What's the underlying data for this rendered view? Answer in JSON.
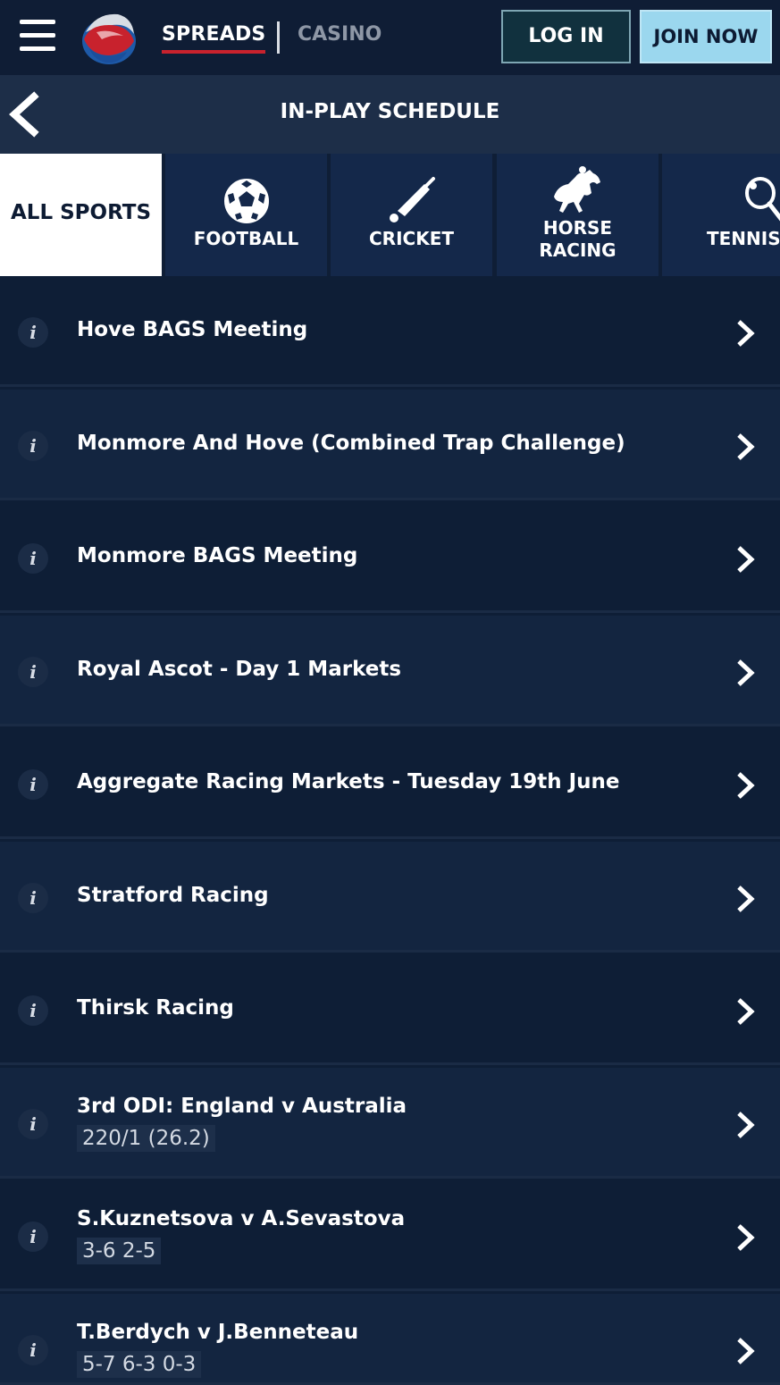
{
  "header": {
    "nav_spreads": "SPREADS",
    "nav_casino": "CASINO",
    "login_label": "LOG IN",
    "join_label": "JOIN NOW"
  },
  "subheader": {
    "title": "IN-PLAY SCHEDULE"
  },
  "sports_tabs": [
    {
      "label": "ALL SPORTS",
      "icon": "none",
      "active": true
    },
    {
      "label": "FOOTBALL",
      "icon": "football-icon",
      "active": false
    },
    {
      "label": "CRICKET",
      "icon": "cricket-bat-icon",
      "active": false
    },
    {
      "label_line1": "HORSE",
      "label_line2": "RACING",
      "icon": "horse-racing-icon",
      "active": false
    },
    {
      "label": "TENNIS",
      "icon": "tennis-racket-icon",
      "active": false
    }
  ],
  "events": [
    {
      "title": "Hove BAGS Meeting",
      "score": ""
    },
    {
      "title": "Monmore And Hove (Combined Trap Challenge)",
      "score": ""
    },
    {
      "title": "Monmore BAGS Meeting",
      "score": ""
    },
    {
      "title": "Royal Ascot - Day 1 Markets",
      "score": ""
    },
    {
      "title": "Aggregate Racing Markets - Tuesday 19th June",
      "score": ""
    },
    {
      "title": "Stratford Racing",
      "score": ""
    },
    {
      "title": "Thirsk Racing",
      "score": ""
    },
    {
      "title": "3rd ODI: England v Australia",
      "score": "220/1 (26.2)"
    },
    {
      "title": "S.Kuznetsova v A.Sevastova",
      "score": "3-6 2-5"
    },
    {
      "title": "T.Berdych v J.Benneteau",
      "score": "5-7 6-3 0-3"
    }
  ],
  "info_glyph": "i",
  "colors": {
    "background": "#0e1e36",
    "accent_red": "#c8222d",
    "join_button": "#9bd7ee",
    "login_border": "#7ea6b3"
  }
}
